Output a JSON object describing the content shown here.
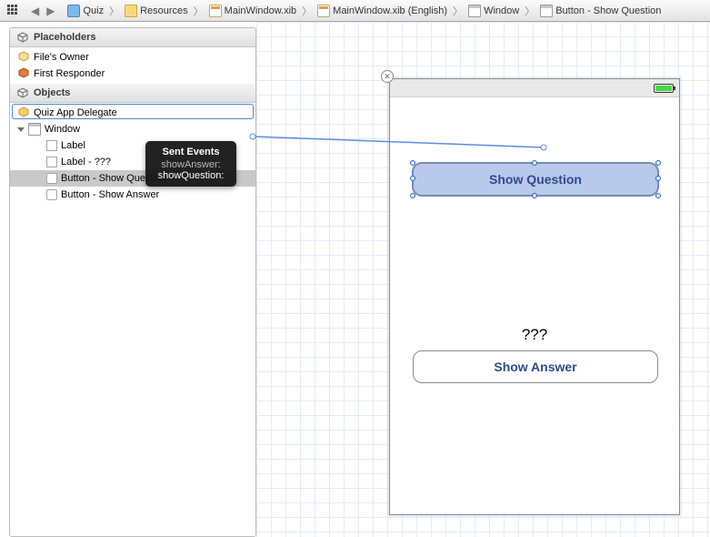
{
  "breadcrumb": {
    "project": "Quiz",
    "folder": "Resources",
    "xib1": "MainWindow.xib",
    "xib2": "MainWindow.xib (English)",
    "window": "Window",
    "element": "Button - Show Question"
  },
  "sidebar": {
    "placeholders_header": "Placeholders",
    "objects_header": "Objects",
    "files_owner": "File's Owner",
    "first_responder": "First Responder",
    "delegate": "Quiz App Delegate",
    "window": "Window",
    "label1": "Label",
    "label2": "Label - ???",
    "btn_q": "Button - Show Question",
    "btn_a": "Button - Show Answer"
  },
  "tooltip": {
    "header": "Sent Events",
    "line1": "showAnswer:",
    "line2": "showQuestion:"
  },
  "canvas": {
    "btn_question": "Show Question",
    "q_label": "???",
    "btn_answer": "Show Answer"
  }
}
